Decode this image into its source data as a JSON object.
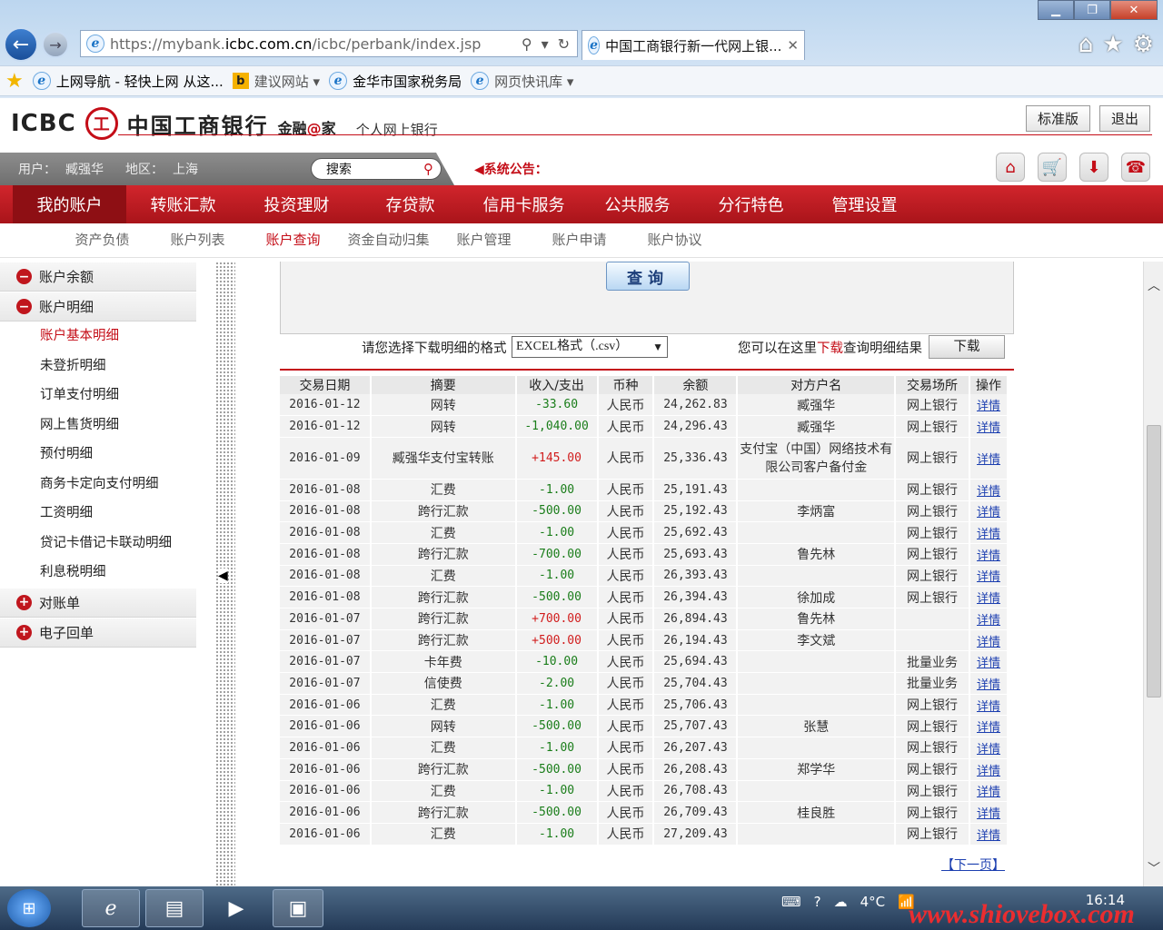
{
  "browser": {
    "url_prefix": "https://mybank.",
    "url_domain": "icbc.com.cn",
    "url_path": "/icbc/perbank/index.jsp",
    "tab_title": "中国工商银行新一代网上银...",
    "favorites": [
      {
        "label": "上网导航 - 轻快上网 从这..."
      },
      {
        "label": "建议网站 ▾"
      },
      {
        "label": "金华市国家税务局"
      },
      {
        "label": "网页快讯库 ▾"
      }
    ]
  },
  "header": {
    "logo_text": "ICBC",
    "bank_name": "中国工商银行",
    "brand_a": "金融",
    "brand_at": "@",
    "brand_b": "家",
    "subtitle": "个人网上银行",
    "standard_btn": "标准版",
    "logout_btn": "退出"
  },
  "infobar": {
    "user_label": "用户：",
    "user_name": "臧强华",
    "region_label": "地区：",
    "region": "上海",
    "search_placeholder": "搜索",
    "notice": "系统公告："
  },
  "main_nav": [
    "我的账户",
    "转账汇款",
    "投资理财",
    "存贷款",
    "信用卡服务",
    "公共服务",
    "分行特色",
    "管理设置"
  ],
  "sub_nav": [
    "资产负债",
    "账户列表",
    "账户查询",
    "资金自动归集",
    "账户管理",
    "账户申请",
    "账户协议"
  ],
  "sidebar": {
    "balance": "账户余额",
    "details": "账户明细",
    "items": [
      "账户基本明细",
      "未登折明细",
      "订单支付明细",
      "网上售货明细",
      "预付明细",
      "商务卡定向支付明细",
      "工资明细",
      "贷记卡借记卡联动明细",
      "利息税明细"
    ],
    "statement": "对账单",
    "receipt": "电子回单"
  },
  "query": {
    "query_btn": "查询",
    "dl_label": "请您选择下载明细的格式",
    "format_value": "EXCEL格式（.csv）",
    "dl_hint_a": "您可以在这里",
    "dl_hint_link": "下载",
    "dl_hint_b": "查询明细结果",
    "download_btn": "下载"
  },
  "table": {
    "headers": [
      "交易日期",
      "摘要",
      "收入/支出",
      "币种",
      "余额",
      "对方户名",
      "交易场所",
      "操作"
    ],
    "rows": [
      [
        "2016-01-12",
        "网转",
        "-33.60",
        "人民币",
        "24,262.83",
        "臧强华",
        "网上银行",
        "详情"
      ],
      [
        "2016-01-12",
        "网转",
        "-1,040.00",
        "人民币",
        "24,296.43",
        "臧强华",
        "网上银行",
        "详情"
      ],
      [
        "2016-01-09",
        "臧强华支付宝转账",
        "+145.00",
        "人民币",
        "25,336.43",
        "支付宝（中国）网络技术有限公司客户备付金",
        "网上银行",
        "详情"
      ],
      [
        "2016-01-08",
        "汇费",
        "-1.00",
        "人民币",
        "25,191.43",
        "",
        "网上银行",
        "详情"
      ],
      [
        "2016-01-08",
        "跨行汇款",
        "-500.00",
        "人民币",
        "25,192.43",
        "李炳富",
        "网上银行",
        "详情"
      ],
      [
        "2016-01-08",
        "汇费",
        "-1.00",
        "人民币",
        "25,692.43",
        "",
        "网上银行",
        "详情"
      ],
      [
        "2016-01-08",
        "跨行汇款",
        "-700.00",
        "人民币",
        "25,693.43",
        "鲁先林",
        "网上银行",
        "详情"
      ],
      [
        "2016-01-08",
        "汇费",
        "-1.00",
        "人民币",
        "26,393.43",
        "",
        "网上银行",
        "详情"
      ],
      [
        "2016-01-08",
        "跨行汇款",
        "-500.00",
        "人民币",
        "26,394.43",
        "徐加成",
        "网上银行",
        "详情"
      ],
      [
        "2016-01-07",
        "跨行汇款",
        "+700.00",
        "人民币",
        "26,894.43",
        "鲁先林",
        "",
        "详情"
      ],
      [
        "2016-01-07",
        "跨行汇款",
        "+500.00",
        "人民币",
        "26,194.43",
        "李文斌",
        "",
        "详情"
      ],
      [
        "2016-01-07",
        "卡年费",
        "-10.00",
        "人民币",
        "25,694.43",
        "",
        "批量业务",
        "详情"
      ],
      [
        "2016-01-07",
        "信使费",
        "-2.00",
        "人民币",
        "25,704.43",
        "",
        "批量业务",
        "详情"
      ],
      [
        "2016-01-06",
        "汇费",
        "-1.00",
        "人民币",
        "25,706.43",
        "",
        "网上银行",
        "详情"
      ],
      [
        "2016-01-06",
        "网转",
        "-500.00",
        "人民币",
        "25,707.43",
        "张慧",
        "网上银行",
        "详情"
      ],
      [
        "2016-01-06",
        "汇费",
        "-1.00",
        "人民币",
        "26,207.43",
        "",
        "网上银行",
        "详情"
      ],
      [
        "2016-01-06",
        "跨行汇款",
        "-500.00",
        "人民币",
        "26,208.43",
        "郑学华",
        "网上银行",
        "详情"
      ],
      [
        "2016-01-06",
        "汇费",
        "-1.00",
        "人民币",
        "26,708.43",
        "",
        "网上银行",
        "详情"
      ],
      [
        "2016-01-06",
        "跨行汇款",
        "-500.00",
        "人民币",
        "26,709.43",
        "桂良胜",
        "网上银行",
        "详情"
      ],
      [
        "2016-01-06",
        "汇费",
        "-1.00",
        "人民币",
        "27,209.43",
        "",
        "网上银行",
        "详情"
      ]
    ],
    "next_page": "【下一页】"
  },
  "taskbar": {
    "weather": "4°C",
    "time": "16:14"
  },
  "watermark": "www.shiovebox.com",
  "colors": {
    "icbc_red": "#c40d17",
    "income": "#d11d1d",
    "expense": "#1a7d1a",
    "link": "#1c3fb0"
  }
}
